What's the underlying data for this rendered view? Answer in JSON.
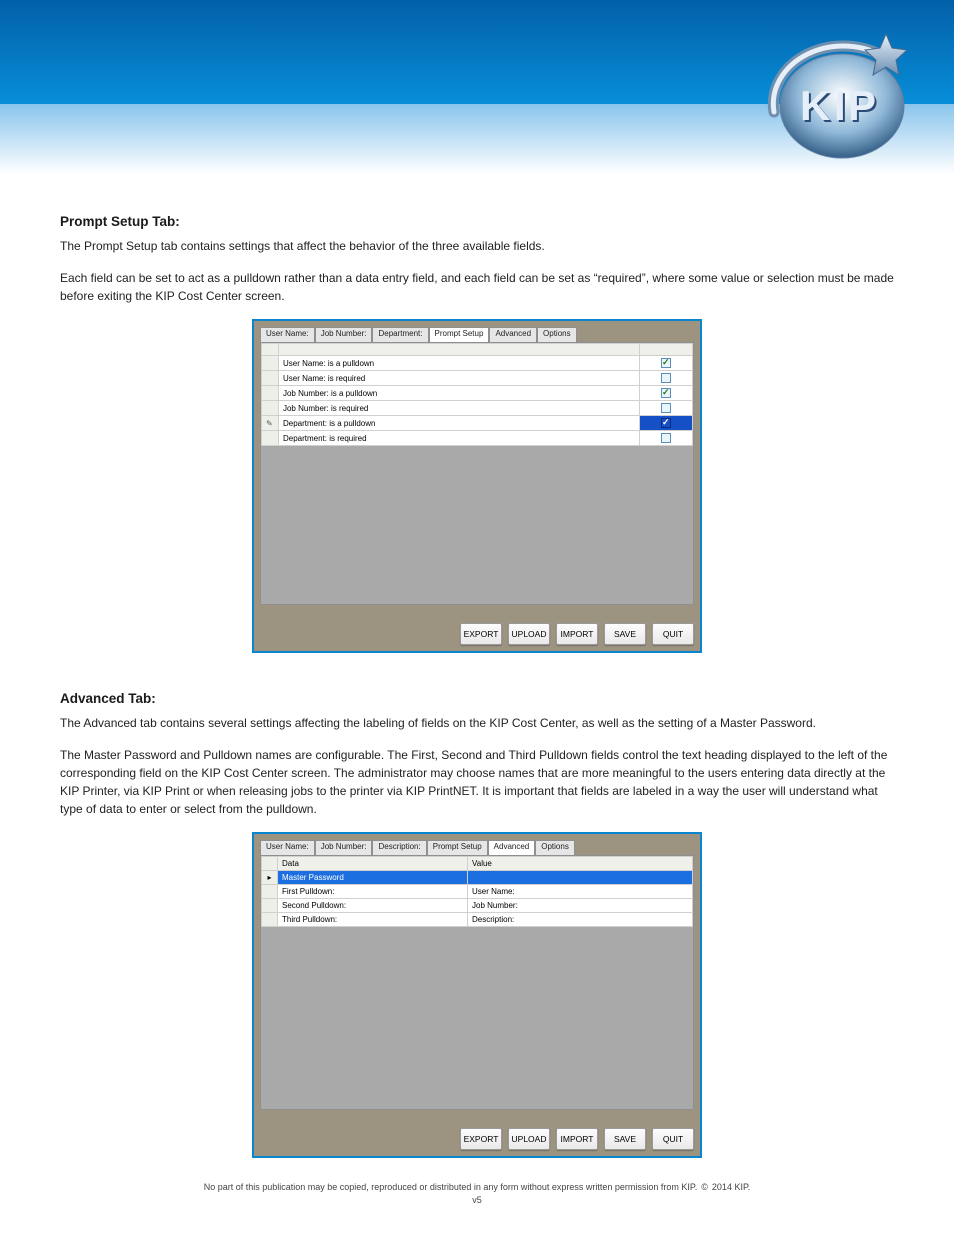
{
  "header": {
    "logo_text": "KIP"
  },
  "sections": {
    "prompt_setup": {
      "title": "Prompt Setup Tab:",
      "body_1": "The Prompt Setup tab contains settings that affect the behavior of the three available fields.",
      "body_2": "Each field can be set to act as a pulldown rather than a data entry field, and each field can be set as “required”, where some value or selection must be made before exiting the KIP Cost Center screen."
    },
    "advanced": {
      "title": "Advanced Tab:",
      "body_1": "The Advanced tab contains several settings affecting the labeling of fields on the KIP Cost Center, as well as the setting of a Master Password.",
      "body_2": "The Master Password and Pulldown names are configurable.  The First, Second and Third Pulldown fields control the text heading displayed to the left of the corresponding field on the KIP Cost Center screen.  The administrator may choose names that are more meaningful to the users entering data directly at the KIP Printer, via KIP Print or when releasing jobs to the printer via KIP PrintNET.  It is important that fields are labeled in a way the user will understand what type of data to enter or select from the pulldown."
    }
  },
  "screenshot1": {
    "tabs": [
      "User Name:",
      "Job Number:",
      "Department:",
      "Prompt Setup",
      "Advanced",
      "Options"
    ],
    "active_tab_index": 3,
    "rows": [
      {
        "label": "User Name: is a pulldown",
        "checked": true,
        "highlighted": false,
        "marker": ""
      },
      {
        "label": "User Name: is required",
        "checked": false,
        "highlighted": false,
        "marker": ""
      },
      {
        "label": "Job Number: is a pulldown",
        "checked": true,
        "highlighted": false,
        "marker": ""
      },
      {
        "label": "Job Number: is required",
        "checked": false,
        "highlighted": false,
        "marker": ""
      },
      {
        "label": "Department: is a pulldown",
        "checked": true,
        "highlighted": true,
        "marker": "pencil"
      },
      {
        "label": "Department: is required",
        "checked": false,
        "highlighted": false,
        "marker": ""
      }
    ],
    "buttons": [
      "EXPORT",
      "UPLOAD",
      "IMPORT",
      "SAVE",
      "QUIT"
    ]
  },
  "screenshot2": {
    "tabs": [
      "User Name:",
      "Job Number:",
      "Description:",
      "Prompt Setup",
      "Advanced",
      "Options"
    ],
    "active_tab_index": 4,
    "columns": [
      "Data",
      "Value"
    ],
    "rows": [
      {
        "data": "Master Password",
        "value": "",
        "selected": true,
        "marker": "▸"
      },
      {
        "data": "First Pulldown:",
        "value": "User Name:",
        "selected": false,
        "marker": ""
      },
      {
        "data": "Second Pulldown:",
        "value": "Job Number:",
        "selected": false,
        "marker": ""
      },
      {
        "data": "Third Pulldown:",
        "value": "Description:",
        "selected": false,
        "marker": ""
      }
    ],
    "buttons": [
      "EXPORT",
      "UPLOAD",
      "IMPORT",
      "SAVE",
      "QUIT"
    ]
  },
  "footer": {
    "line1_pre": "No part of this publication may be copied, reproduced or distributed in any form without express written permission from KIP.",
    "copyright_symbol": "©",
    "line1_post": "2014 KIP.",
    "version": "v5"
  }
}
